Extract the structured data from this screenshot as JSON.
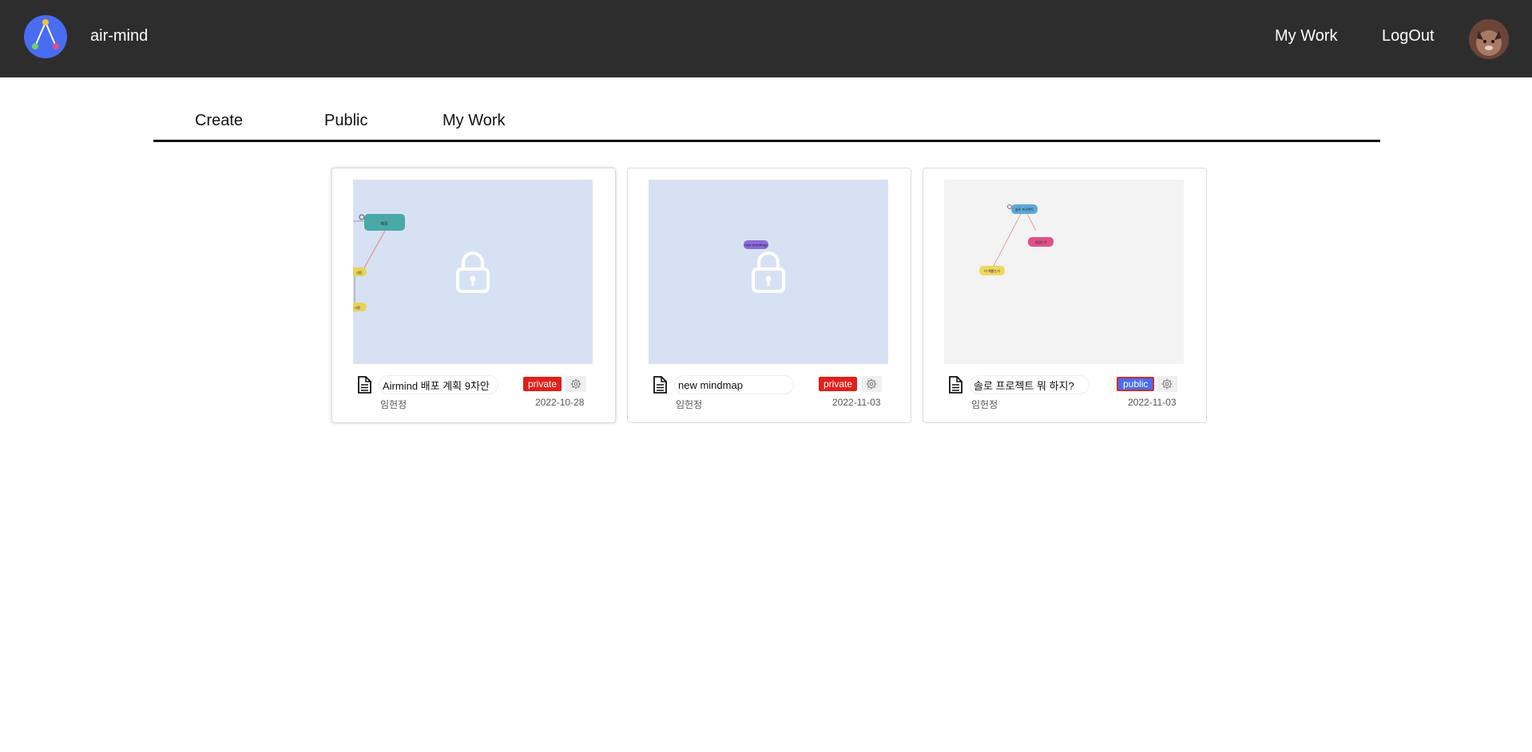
{
  "header": {
    "brand": "air-mind",
    "nav": {
      "my_work": "My Work",
      "logout": "LogOut"
    },
    "colors": {
      "bar": "#2d2d2d",
      "logo": "#4a6cf0"
    }
  },
  "tabs": [
    "Create",
    "Public",
    "My Work"
  ],
  "cards": [
    {
      "title": "Airmind 배포 계획 9차안",
      "visibility": "private",
      "author": "임헌정",
      "date": "2022-10-28",
      "locked": true,
      "nodes": [
        "제목"
      ]
    },
    {
      "title": "new mindmap",
      "visibility": "private",
      "author": "임헌정",
      "date": "2022-11-03",
      "locked": true,
      "nodes": [
        "new mindmap"
      ]
    },
    {
      "title": "솔로 프로젝트 뭐 하지?",
      "visibility": "public",
      "author": "임헌정",
      "date": "2022-11-03",
      "locked": false,
      "nodes": [
        "솔로 프로젝트",
        "게임는거",
        "이 해봤는거"
      ]
    }
  ],
  "icons": {
    "doc": "document-icon",
    "settings": "gear-icon",
    "lock": "lock-icon"
  },
  "colors": {
    "private_badge": "#e0201a",
    "public_badge": "#4a6cf0",
    "locked_thumb": "#d6e2f4"
  }
}
